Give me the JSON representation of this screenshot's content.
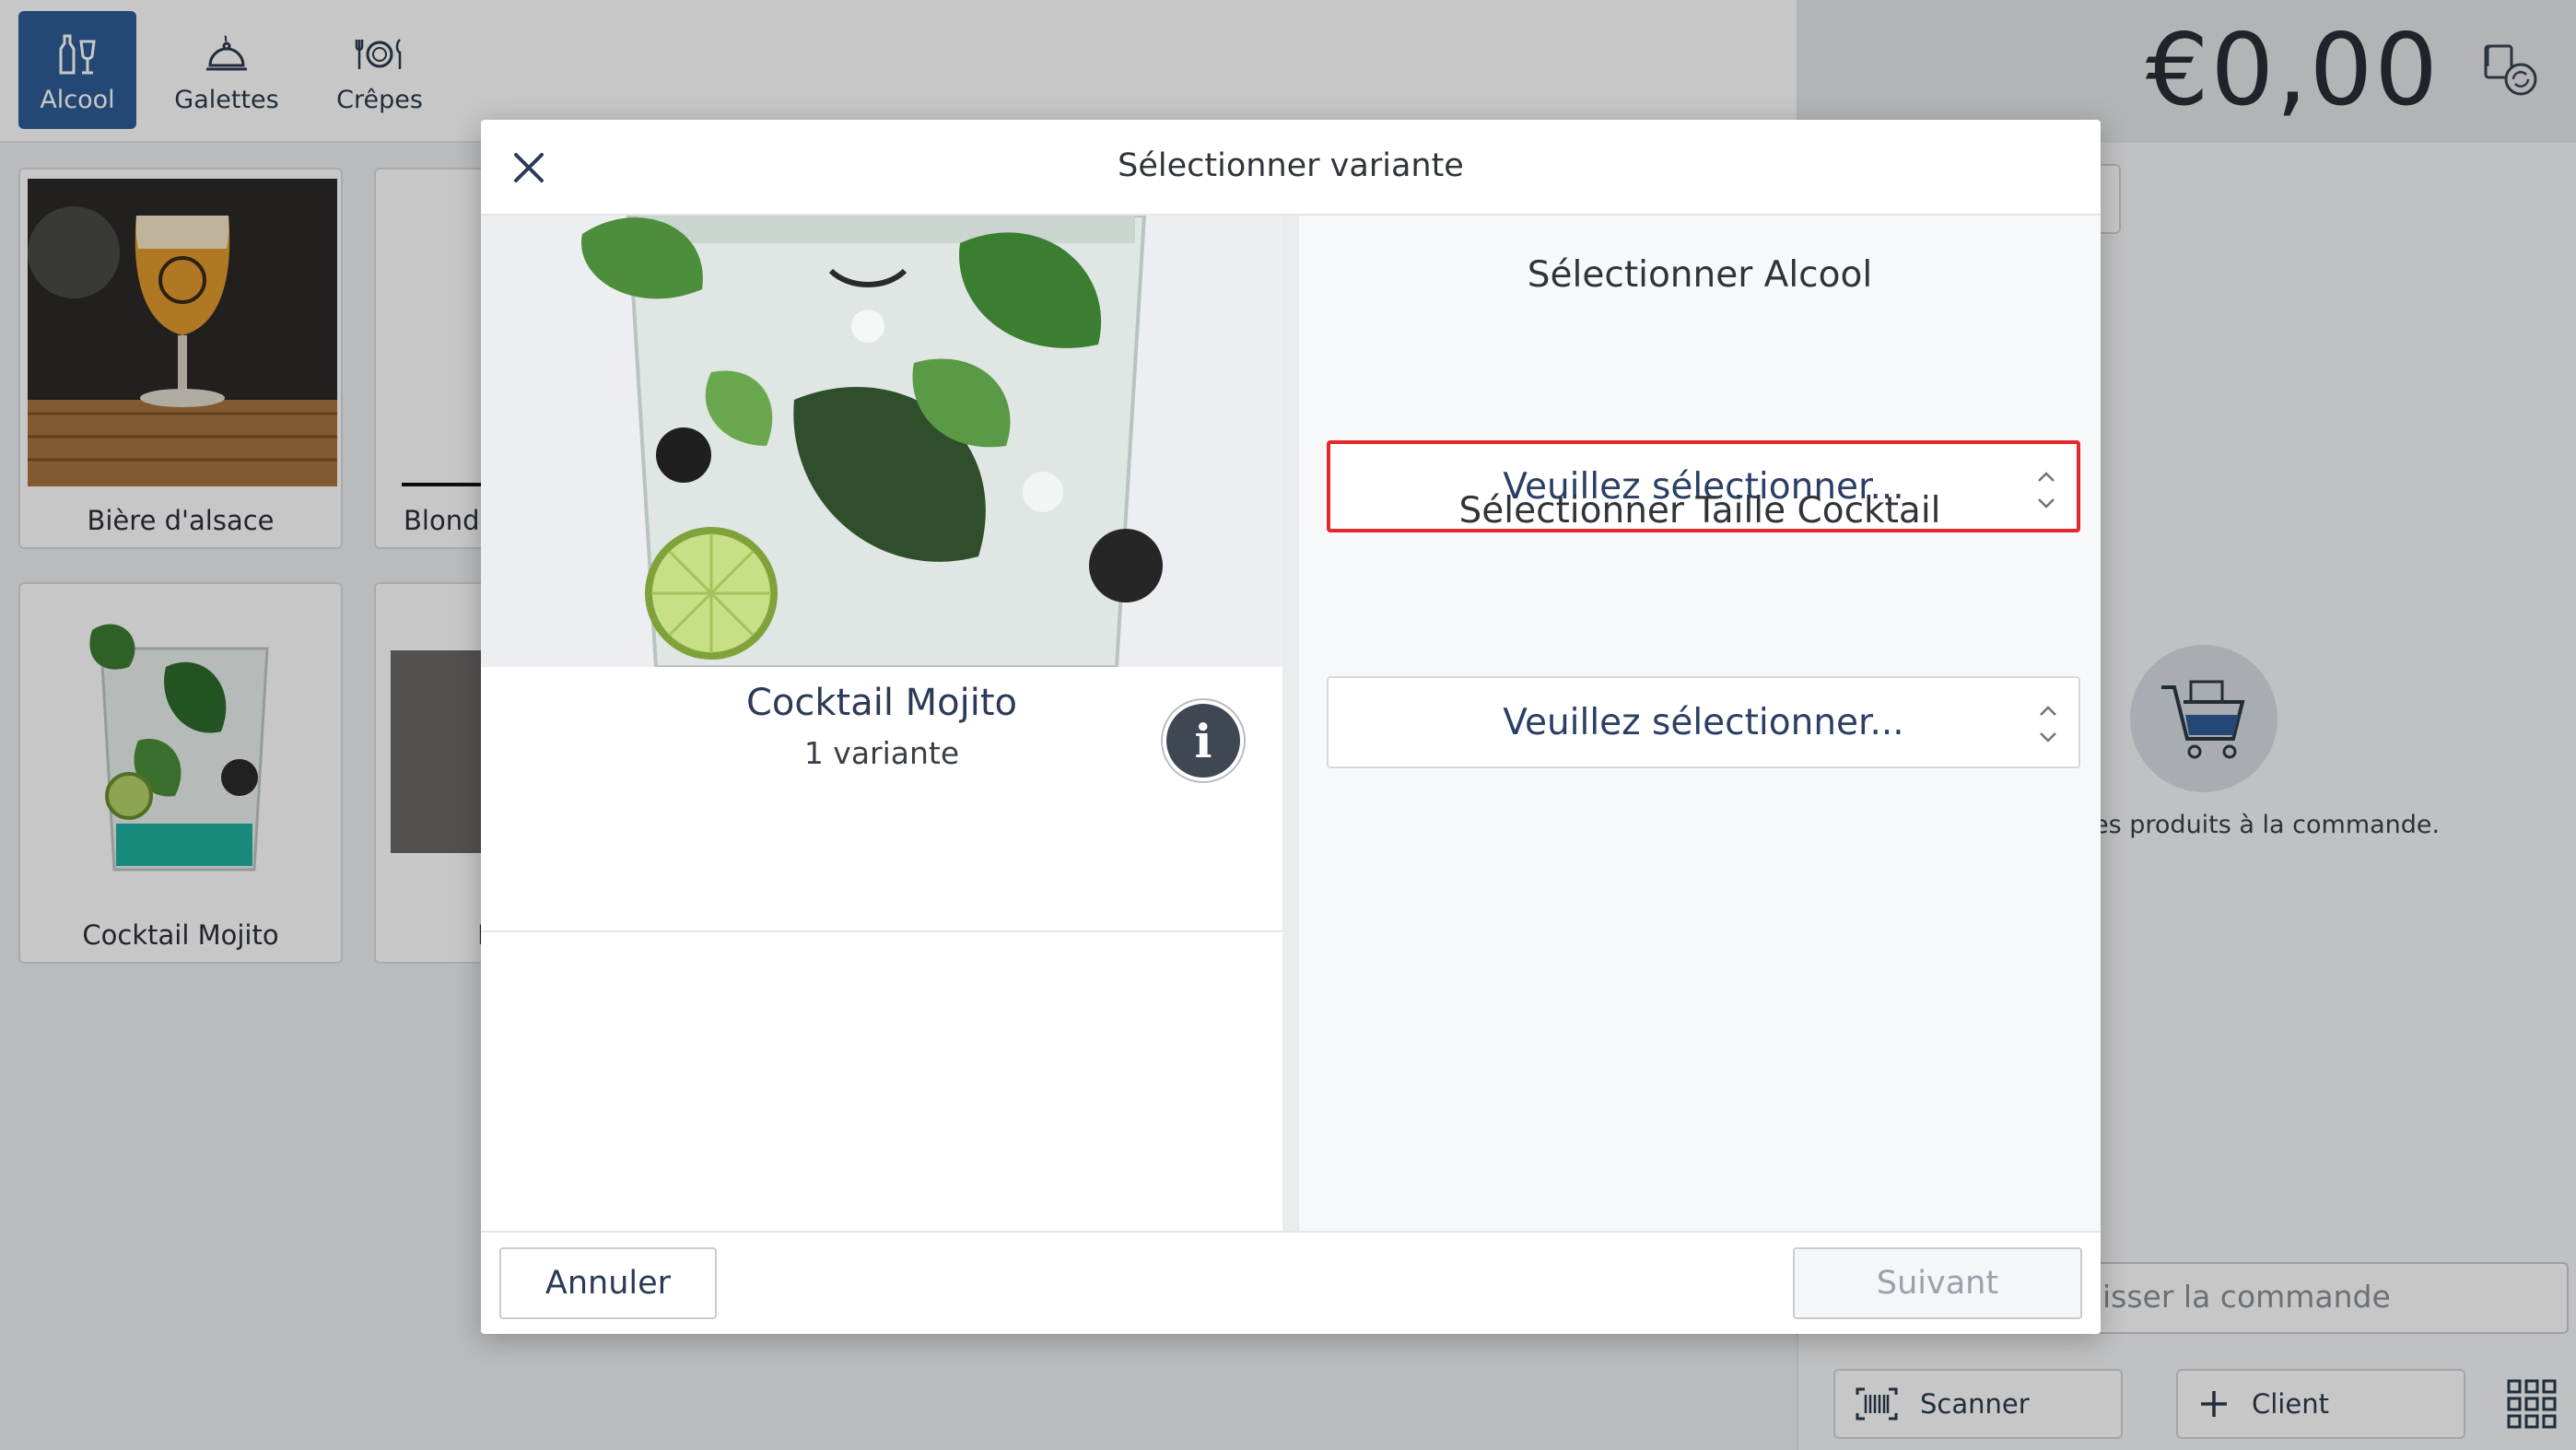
{
  "categories": [
    {
      "label": "Alcool",
      "icon": "bottle-glass-icon",
      "active": true
    },
    {
      "label": "Galettes",
      "icon": "cloche-icon",
      "active": false
    },
    {
      "label": "Crêpes",
      "icon": "plate-cutlery-icon",
      "active": false
    }
  ],
  "products": [
    {
      "label": "Bière d'alsace"
    },
    {
      "label": "Blonde"
    },
    {
      "label": "Cocktail Mojito"
    },
    {
      "label": "I"
    }
  ],
  "order": {
    "total": "€0,00",
    "empty_message": "es produits à la commande.",
    "finish_label": "isser la commande",
    "scanner_label": "Scanner",
    "client_label": "Client"
  },
  "dialog": {
    "title": "Sélectionner variante",
    "product_name": "Cocktail Mojito",
    "variant_count": "1 variante",
    "info_glyph": "i",
    "selectors": [
      {
        "label": "Sélectionner Alcool",
        "value": "Veuillez sélectionner..."
      },
      {
        "label": "Sélectionner Taille Cocktail",
        "value": "Veuillez sélectionner..."
      }
    ],
    "cancel_label": "Annuler",
    "next_label": "Suivant"
  },
  "colors": {
    "accent": "#2f5d96",
    "highlight": "#e2282c"
  }
}
